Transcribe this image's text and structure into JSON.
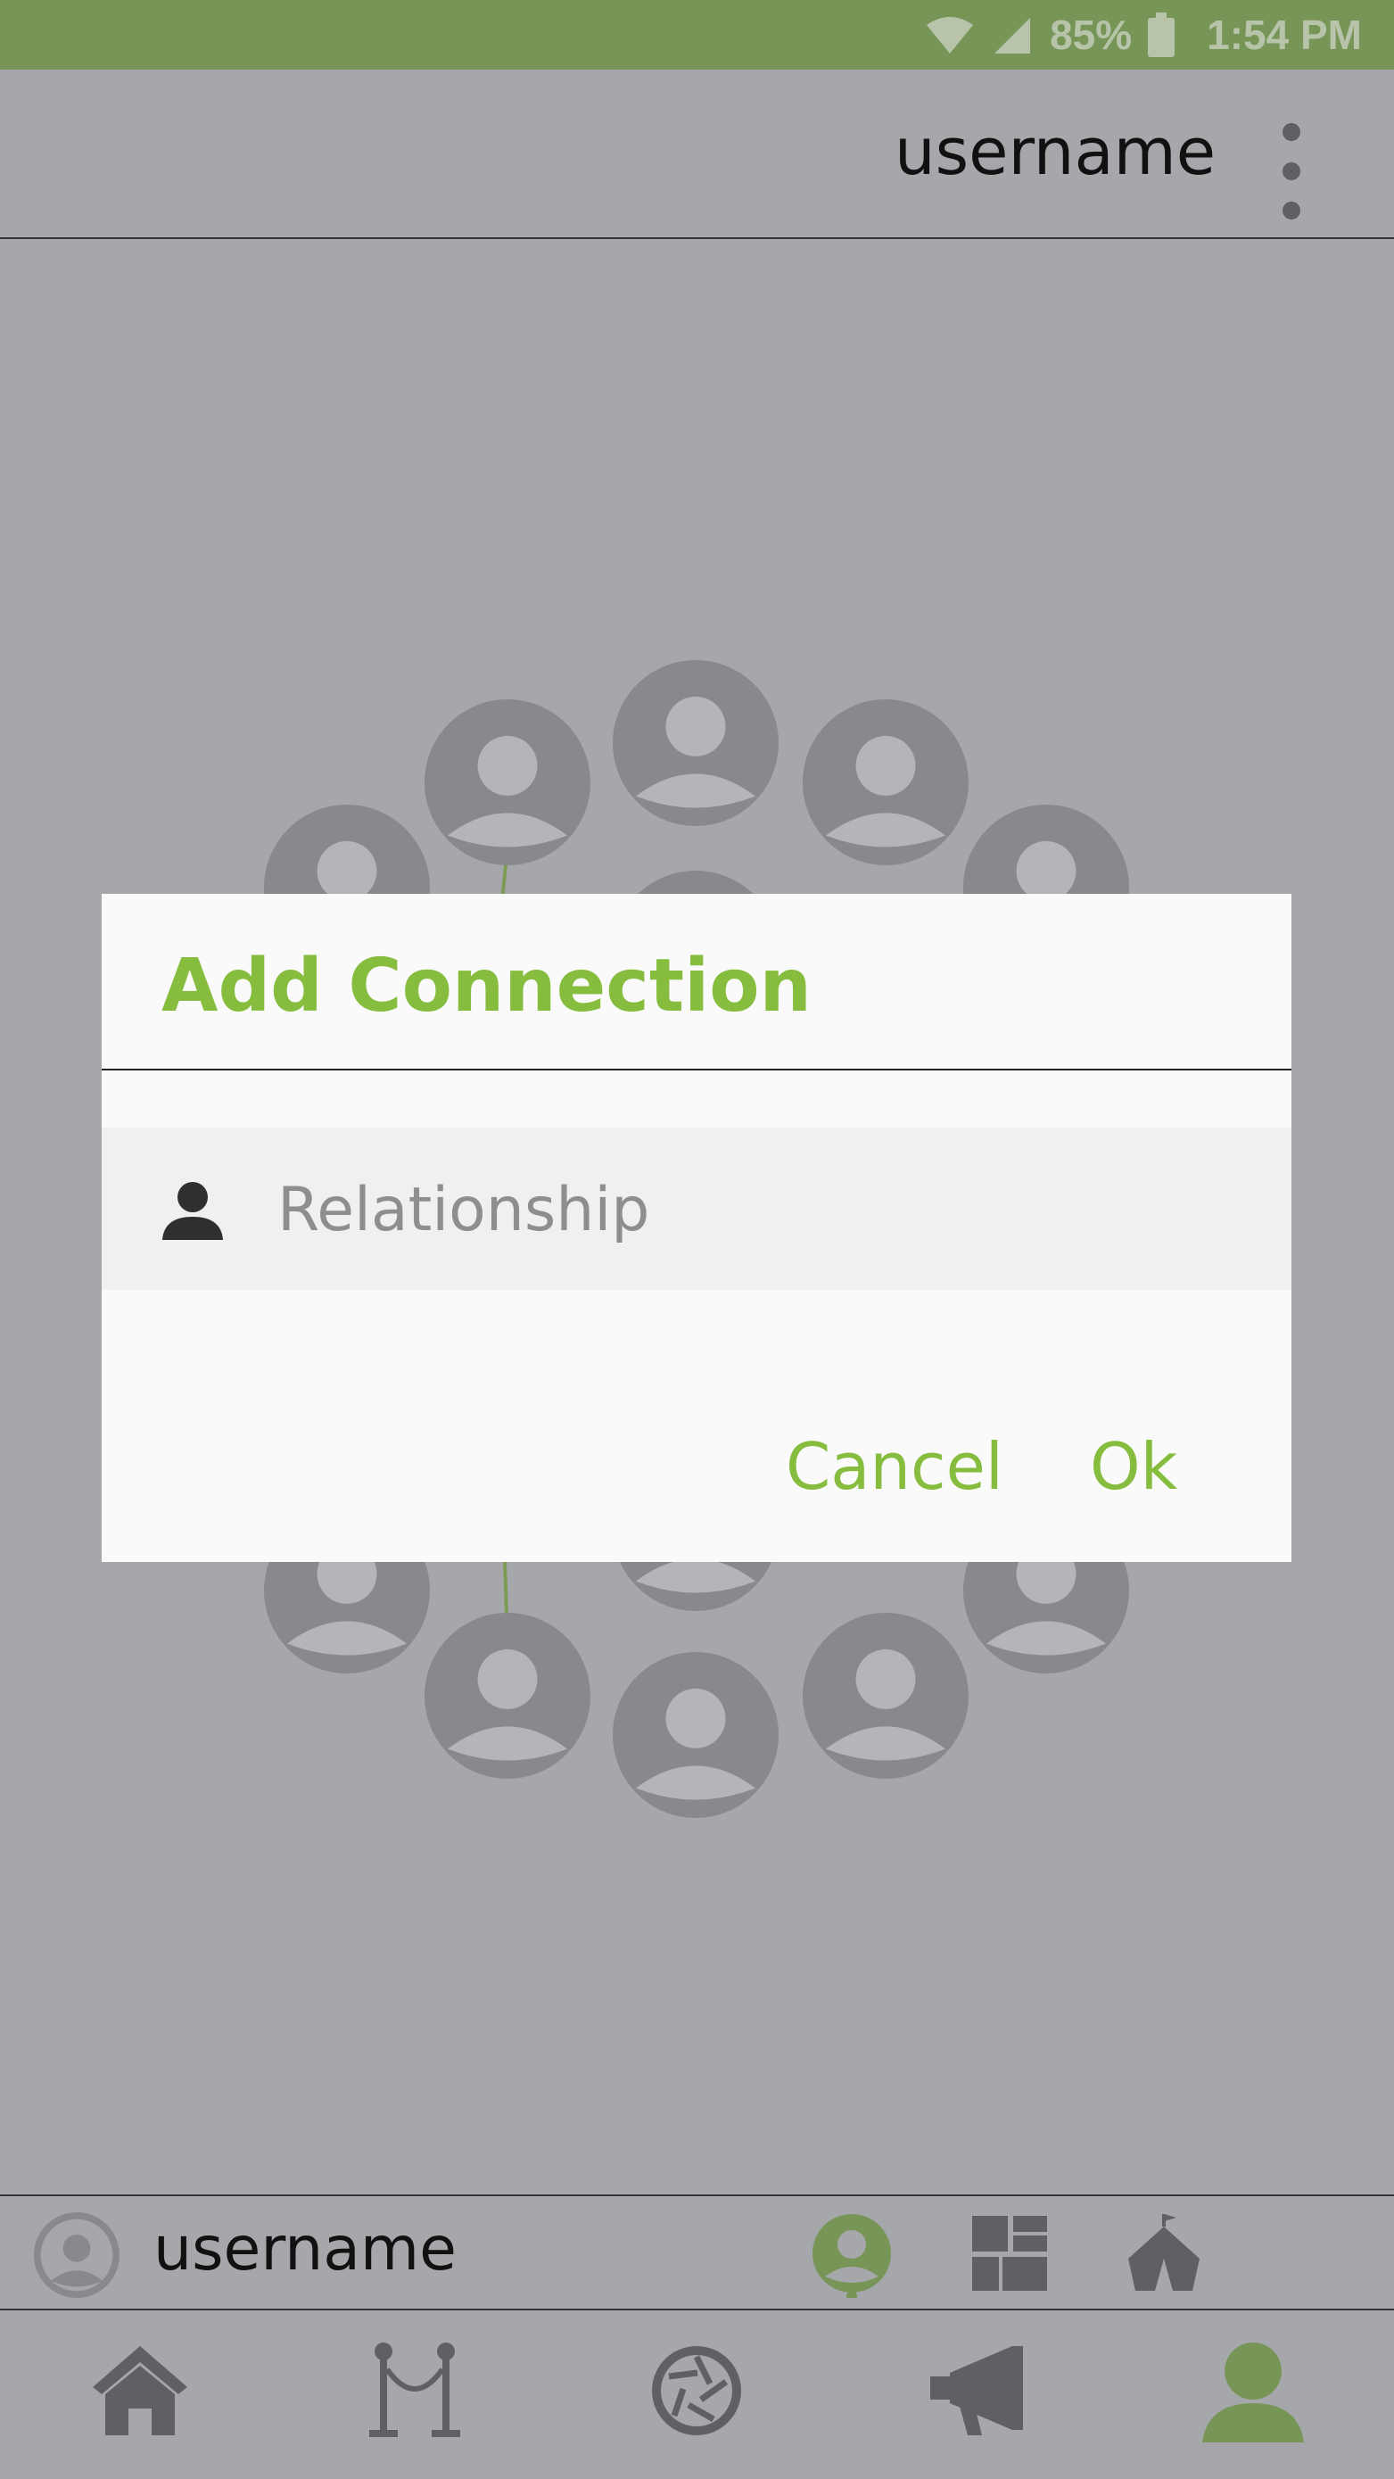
{
  "status_bar": {
    "battery": "85%",
    "time": "1:54 PM"
  },
  "app_bar": {
    "title": "username",
    "menu_icon": "more-vert-icon"
  },
  "dialog": {
    "title": "Add Connection",
    "field_icon": "person-icon",
    "field_placeholder": "Relationship",
    "field_value": "",
    "cancel_label": "Cancel",
    "ok_label": "Ok"
  },
  "user_bar": {
    "name": "username",
    "tabs": [
      "profile-tab-icon",
      "grid-tab-icon",
      "tent-tab-icon"
    ],
    "active_tab": "profile-tab-icon"
  },
  "bottom_nav": {
    "items": [
      "home-icon",
      "rope-barrier-icon",
      "camera-shutter-icon",
      "megaphone-icon",
      "person-icon"
    ],
    "active_item": "person-icon"
  },
  "colors": {
    "accent": "#86bd3e",
    "status_bar": "#789558",
    "background": "#a6a7ab",
    "avatar_node": "#88898d"
  }
}
